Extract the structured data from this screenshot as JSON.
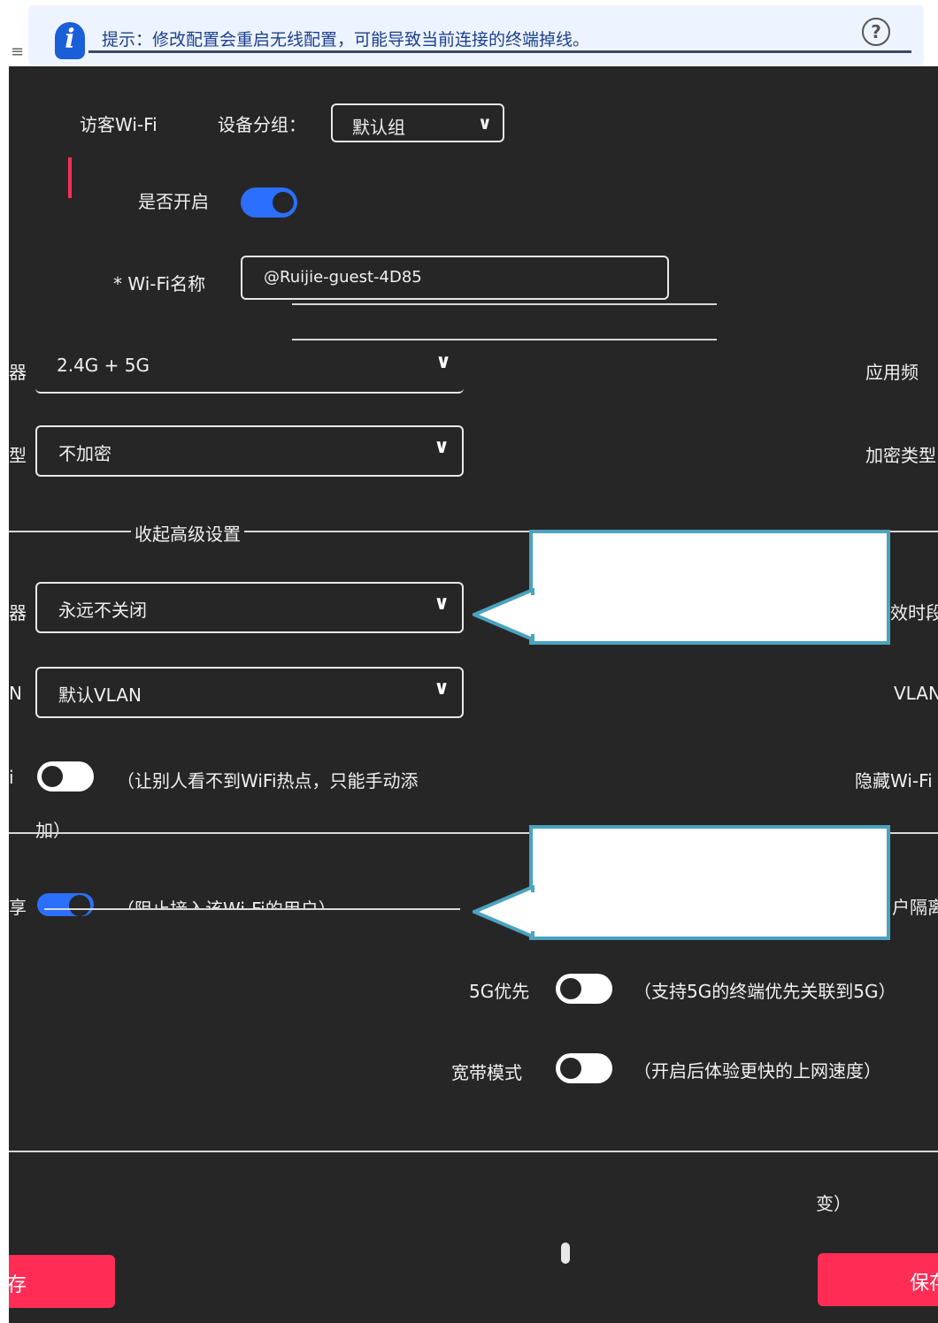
{
  "tip": {
    "text": "提示：修改配置会重启无线配置，可能导致当前连接的终端掉线。",
    "icon": "info-icon"
  },
  "help_icon": "?",
  "menu_icon": "≡",
  "section": {
    "title": "访客Wi-Fi",
    "group_label": "设备分组：",
    "group_value": "默认组"
  },
  "enable": {
    "label": "是否开启",
    "state": "on"
  },
  "ssid": {
    "label": "* Wi-Fi名称",
    "value": "@Ruijie-guest-4D85"
  },
  "band": {
    "value": "2.4G + 5G",
    "right_label": "应用频"
  },
  "encryption": {
    "value": "不加密",
    "right_label": "加密类型"
  },
  "advanced_toggle": "收起高级设置",
  "timer": {
    "value": "永远不关闭",
    "right_label": "效时段"
  },
  "vlan": {
    "value": "默认VLAN",
    "right_label": "VLAN"
  },
  "hidden": {
    "left_label": "i",
    "desc": "（让别人看不到WiFi热点，只能手动添",
    "desc2": "加）",
    "right_label": "隐藏Wi-Fi"
  },
  "isolate": {
    "desc": "（阻止接入该Wi-Fi的用户）",
    "right_label": "户隔离"
  },
  "five_g": {
    "label": "5G优先",
    "desc": "（支持5G的终端优先关联到5G）"
  },
  "fast": {
    "label": "宽带模式",
    "desc": "（开启后体验更快的上网速度）"
  },
  "bottom_row": {
    "desc_tail": "变）"
  },
  "save_left": "存",
  "save_right": "保存",
  "left_cut": {
    "band": "器",
    "encryption": "型",
    "timer": "器",
    "vlan": "N",
    "isolate": "享"
  }
}
